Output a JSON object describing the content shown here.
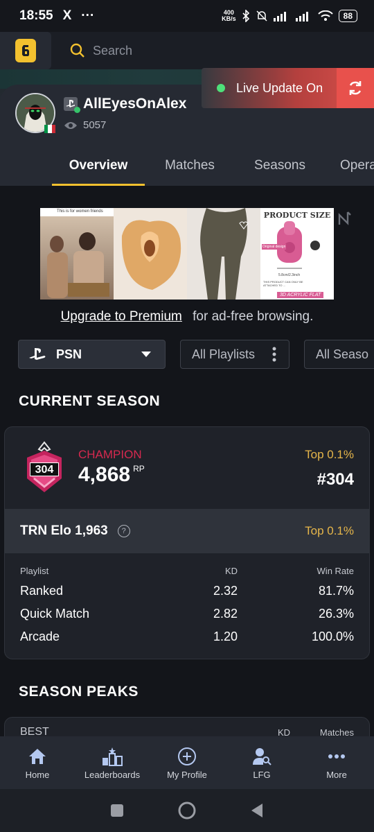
{
  "status_bar": {
    "time": "18:55",
    "x_icon": "X",
    "more": "···",
    "speed_top": "400",
    "speed_bottom": "KB/s",
    "battery": "88"
  },
  "search": {
    "placeholder": "Search"
  },
  "live_update": {
    "label": "Live Update On"
  },
  "profile": {
    "name": "AllEyesOnAlex",
    "views": "5057",
    "flag_colors": [
      "#009246",
      "#ffffff",
      "#ce2b37"
    ]
  },
  "tabs": [
    "Overview",
    "Matches",
    "Seasons",
    "Opera"
  ],
  "ad": {
    "panel1_text": "This is for women friends",
    "panel4_title": "PRODUCT SIZE",
    "panel4_label": "Original design",
    "panel4_size": "5.8cm/2.3inch",
    "panel4_note": "THIS PRODUCT CAN ONLY BE ATTACHED TO ...",
    "panel4_footer": "3D ACRYLIC FLAT"
  },
  "premium": {
    "link": "Upgrade to Premium",
    "text": "for ad-free browsing."
  },
  "filters": {
    "platform": "PSN",
    "playlist": "All Playlists",
    "season": "All Seaso"
  },
  "current_season": {
    "title": "CURRENT SEASON",
    "rank_name": "CHAMPION",
    "badge_number": "304",
    "rp": "4,868",
    "rp_unit": "RP",
    "top_rank": "Top 0.1%",
    "rank_position": "#304",
    "elo_label": "TRN Elo 1,963",
    "elo_help": "?",
    "elo_top": "Top 0.1%",
    "table": {
      "headers": [
        "Playlist",
        "KD",
        "Win Rate"
      ],
      "rows": [
        [
          "Ranked",
          "2.32",
          "81.7%"
        ],
        [
          "Quick Match",
          "2.82",
          "26.3%"
        ],
        [
          "Arcade",
          "1.20",
          "100.0%"
        ]
      ]
    }
  },
  "season_peaks": {
    "title": "SEASON PEAKS",
    "headers": [
      "BEST",
      "KD",
      "Matches"
    ]
  },
  "bottom_nav": [
    "Home",
    "Leaderboards",
    "My Profile",
    "LFG",
    "More"
  ],
  "colors": {
    "accent": "#f3c12f",
    "champion": "#d6294f",
    "top": "#e6b64a",
    "live": "#e8514c"
  }
}
